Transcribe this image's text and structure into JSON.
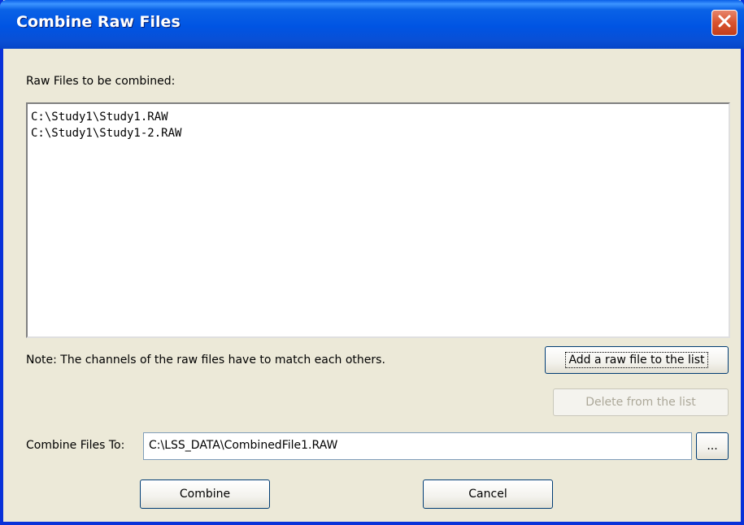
{
  "window": {
    "title": "Combine Raw Files",
    "close_icon": "close-icon"
  },
  "files_label": "Raw Files to be combined:",
  "files": [
    "C:\\Study1\\Study1.RAW",
    "C:\\Study1\\Study1-2.RAW"
  ],
  "note": "Note: The channels of the raw files have to match each others.",
  "buttons": {
    "add": "Add a raw file to the list",
    "delete": "Delete from the list",
    "browse": "...",
    "combine": "Combine",
    "cancel": "Cancel"
  },
  "output": {
    "label": "Combine Files To:",
    "value": "C:\\LSS_DATA\\CombinedFile1.RAW"
  },
  "colors": {
    "titlebar": "#0054e3",
    "dialog_bg": "#ece9d8",
    "close_button": "#d9532f"
  }
}
